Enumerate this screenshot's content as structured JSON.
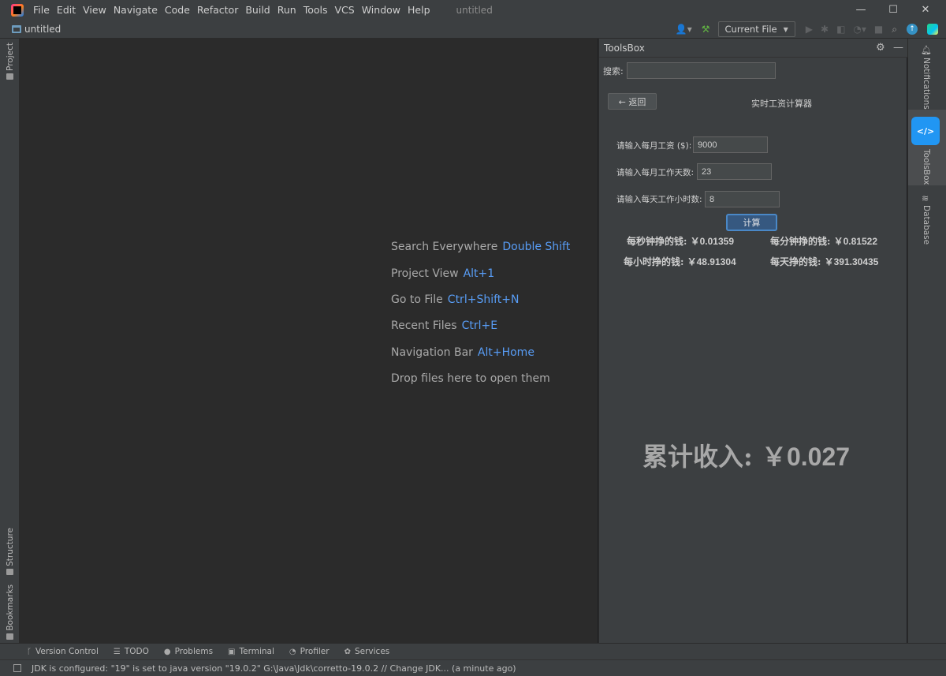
{
  "menu": {
    "items": [
      "File",
      "Edit",
      "View",
      "Navigate",
      "Code",
      "Refactor",
      "Build",
      "Run",
      "Tools",
      "VCS",
      "Window",
      "Help"
    ],
    "window_title": "untitled"
  },
  "navbar": {
    "project_name": "untitled",
    "run_config": "Current File"
  },
  "left_strip": {
    "project": "Project",
    "structure": "Structure",
    "bookmarks": "Bookmarks"
  },
  "editor": {
    "hints": [
      {
        "label": "Search Everywhere",
        "shortcut": "Double Shift"
      },
      {
        "label": "Project View",
        "shortcut": "Alt+1"
      },
      {
        "label": "Go to File",
        "shortcut": "Ctrl+Shift+N"
      },
      {
        "label": "Recent Files",
        "shortcut": "Ctrl+E"
      },
      {
        "label": "Navigation Bar",
        "shortcut": "Alt+Home"
      },
      {
        "label": "Drop files here to open them",
        "shortcut": ""
      }
    ]
  },
  "toolsbox": {
    "title": "ToolsBox",
    "search_label": "搜索:",
    "search_value": "",
    "back_label": "← 返回",
    "calc_title": "实时工资计算器",
    "fields": {
      "salary_label": "请输入每月工资 ($):",
      "salary_value": "9000",
      "days_label": "请输入每月工作天数:",
      "days_value": "23",
      "hours_label": "请输入每天工作小时数:",
      "hours_value": "8"
    },
    "calc_button": "计算",
    "results": {
      "per_second_label": "每秒钟挣的钱: ",
      "per_second_value": "￥0.01359",
      "per_minute_label": "每分钟挣的钱: ",
      "per_minute_value": "￥0.81522",
      "per_hour_label": "每小时挣的钱: ",
      "per_hour_value": "￥48.91304",
      "per_day_label": "每天挣的钱: ",
      "per_day_value": "￥391.30435"
    },
    "total_label": "累计收入: ",
    "total_value": "￥0.027"
  },
  "right_strip": {
    "notifications": "Notifications",
    "toolsbox": "ToolsBox",
    "database": "Database"
  },
  "bottom_tabs": [
    "Version Control",
    "TODO",
    "Problems",
    "Terminal",
    "Profiler",
    "Services"
  ],
  "status": {
    "message": "JDK is configured: \"19\" is set to java version \"19.0.2\" G:\\Java\\Jdk\\corretto-19.0.2 // Change JDK... (a minute ago)"
  },
  "colors": {
    "accent": "#589df6",
    "toolsbox_icon": "#2196f3",
    "editor_bg": "#2b2b2b",
    "panel_bg": "#3c3f41"
  }
}
